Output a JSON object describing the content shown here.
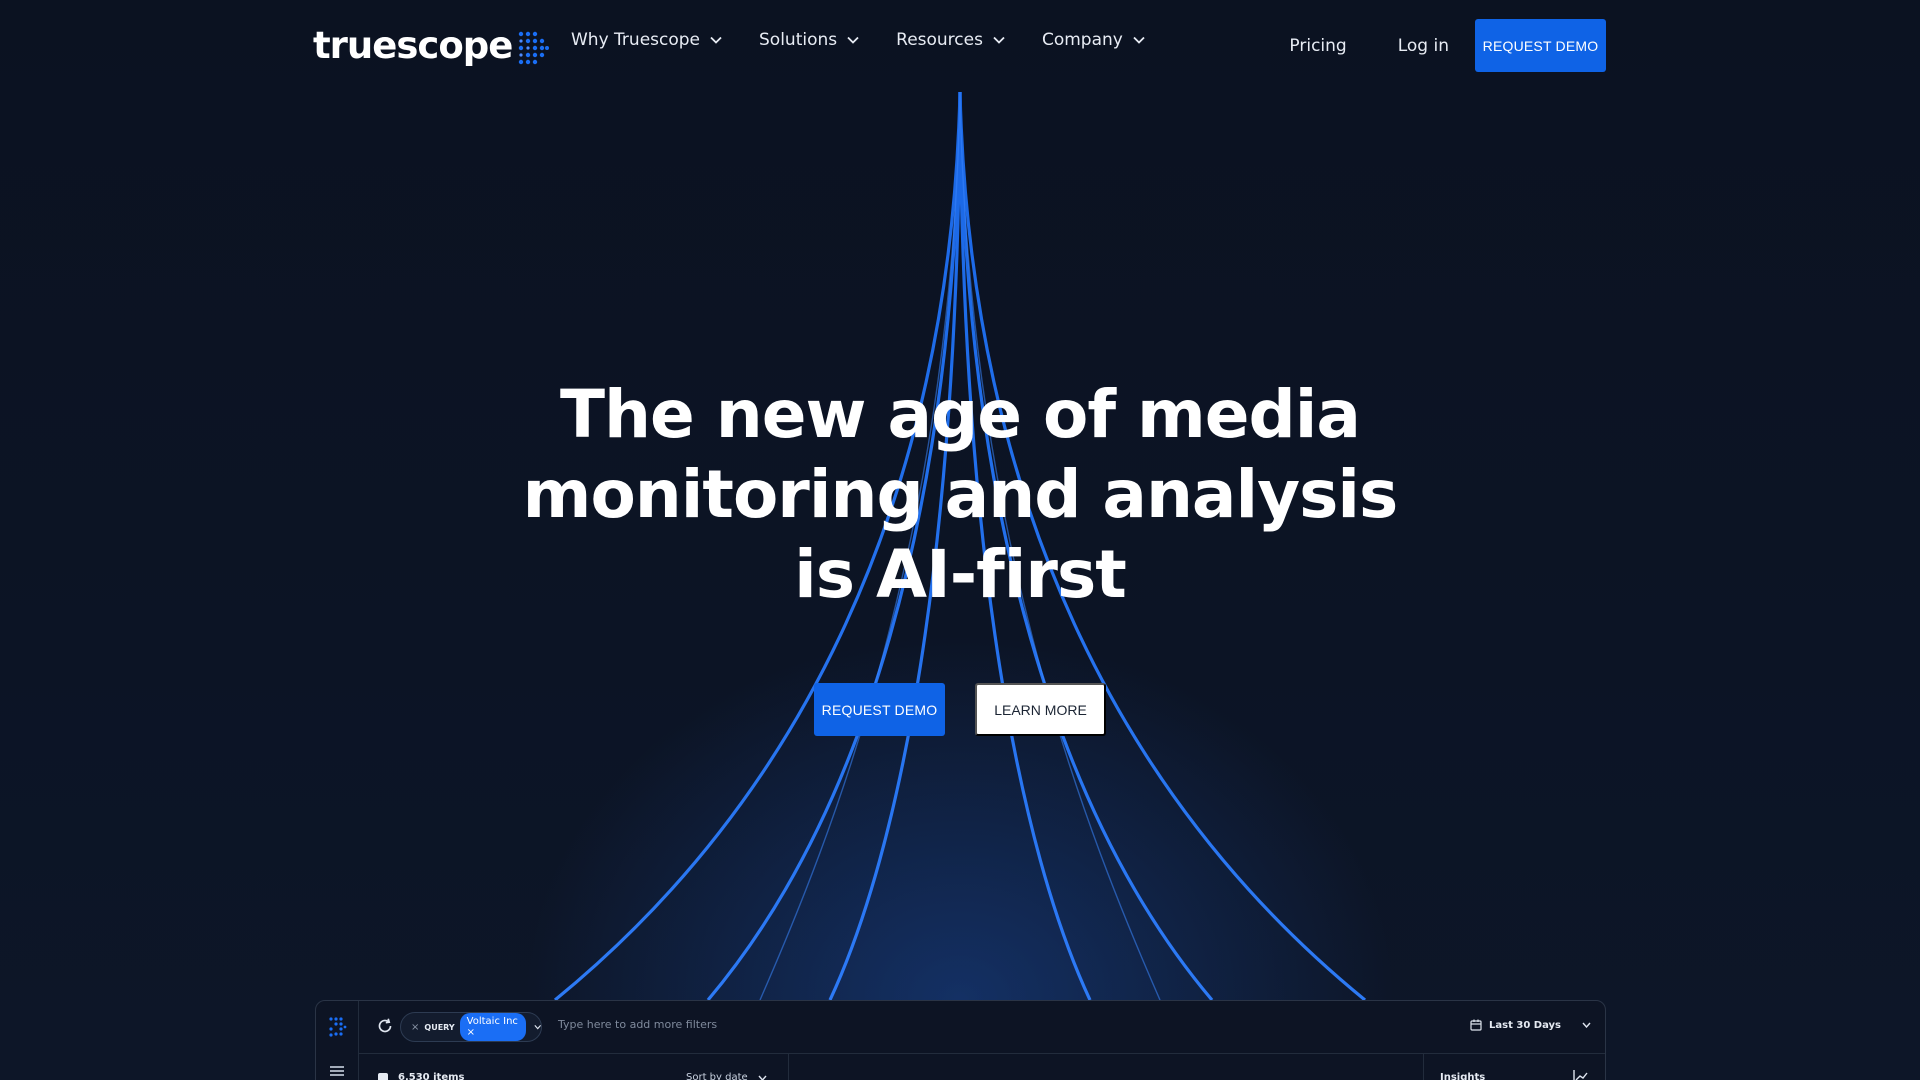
{
  "brand": {
    "name": "truescope",
    "accent": "#0f63e6"
  },
  "nav": {
    "menu": [
      {
        "label": "Why Truescope"
      },
      {
        "label": "Solutions"
      },
      {
        "label": "Resources"
      },
      {
        "label": "Company"
      }
    ],
    "pricing": "Pricing",
    "login": "Log in",
    "cta": "REQUEST DEMO"
  },
  "hero": {
    "title_line1": "The new age of media",
    "title_line2": "monitoring and analysis",
    "title_line3": "is AI-first",
    "cta_primary": "REQUEST DEMO",
    "cta_secondary": "LEARN MORE"
  },
  "app_preview": {
    "query_label": "QUERY",
    "query_value": "Voltaic Inc ×",
    "chip_remove": "×",
    "filter_placeholder": "Type here to add more filters",
    "date_range": "Last 30 Days",
    "items_count": "6,530 items",
    "sort_label": "Sort by date",
    "insights_label": "Insights",
    "icons": [
      "refresh-icon",
      "calendar-icon",
      "menu-icon",
      "chart-icon",
      "chevron-down-icon"
    ]
  }
}
